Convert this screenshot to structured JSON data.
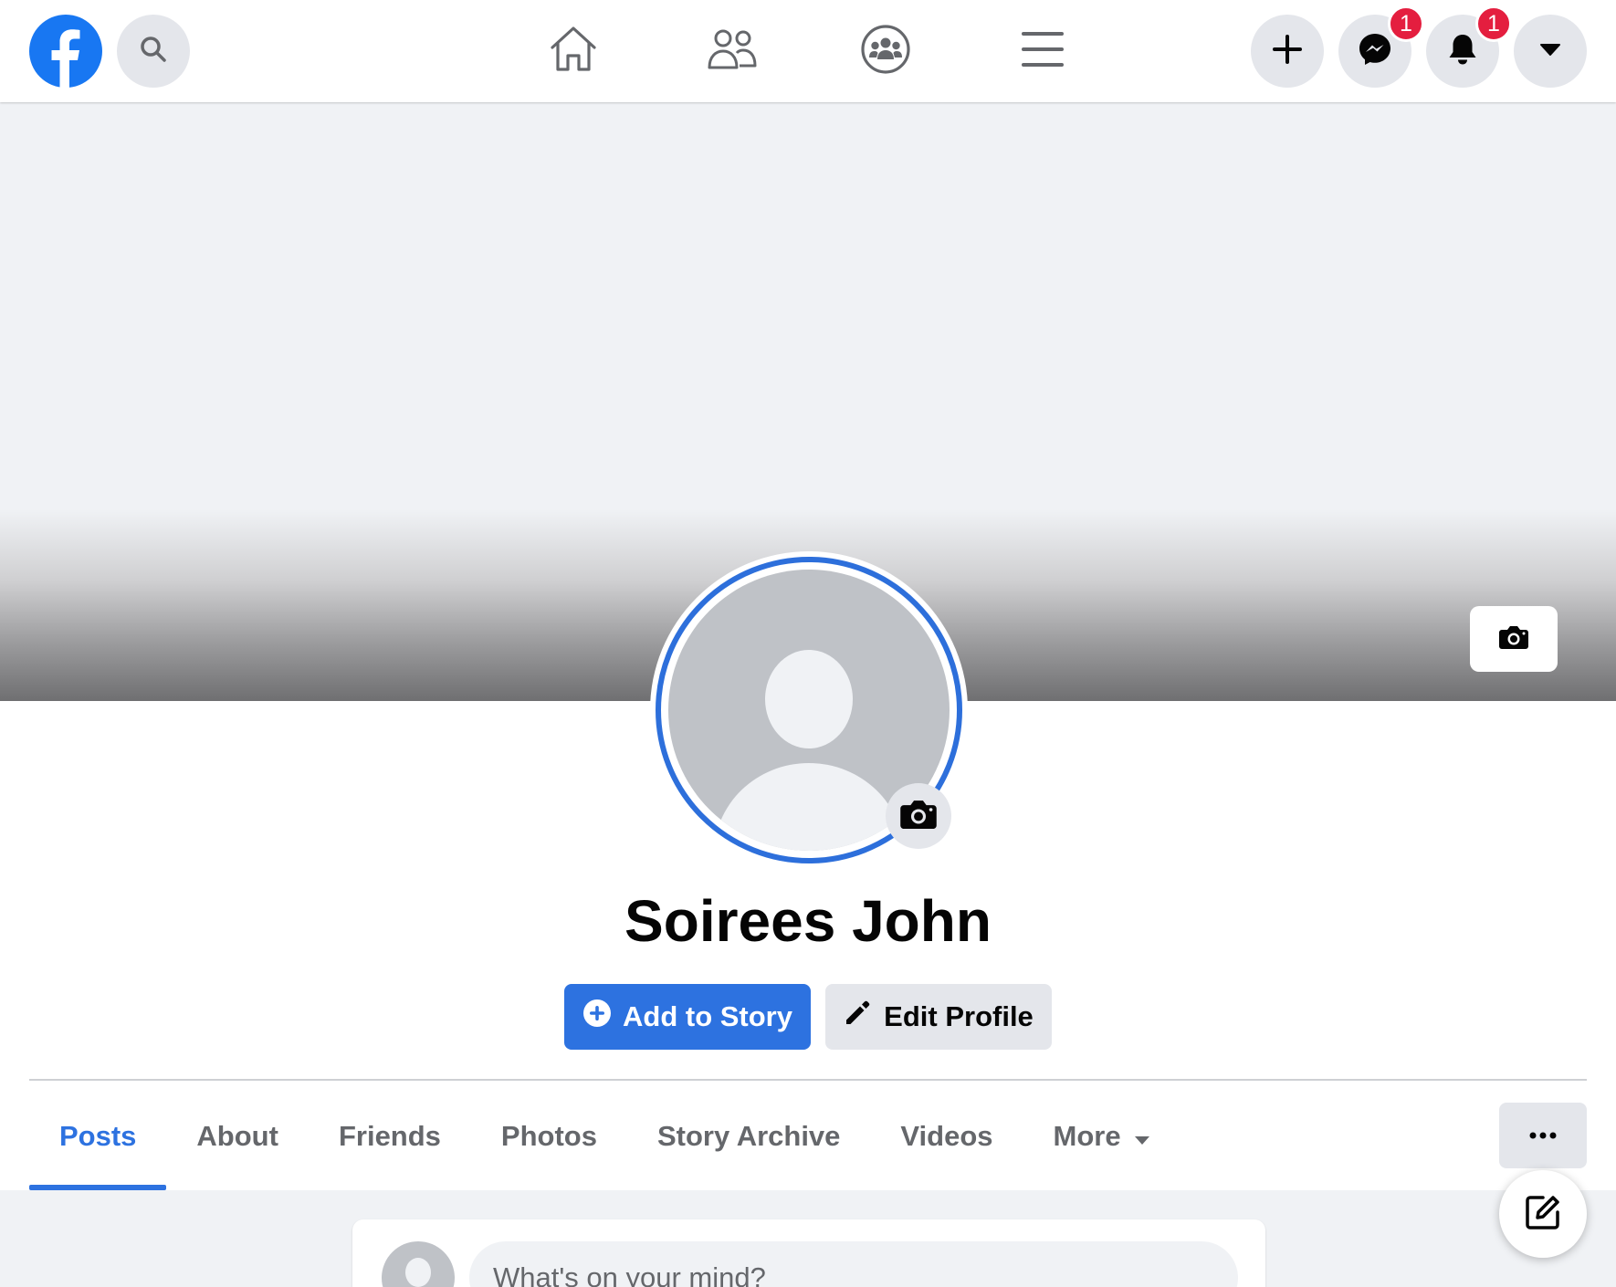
{
  "profile": {
    "name": "Soirees John"
  },
  "actions": {
    "add_story_label": "Add to Story",
    "edit_profile_label": "Edit Profile"
  },
  "tabs": [
    {
      "label": "Posts",
      "active": true
    },
    {
      "label": "About"
    },
    {
      "label": "Friends"
    },
    {
      "label": "Photos"
    },
    {
      "label": "Story Archive"
    },
    {
      "label": "Videos"
    },
    {
      "label": "More"
    }
  ],
  "composer": {
    "placeholder": "What's on your mind?"
  },
  "badges": {
    "messenger": "1",
    "notifications": "1"
  },
  "icons": [
    "facebook-logo",
    "search-icon",
    "home-icon",
    "friends-icon",
    "groups-icon",
    "menu-icon",
    "plus-icon",
    "messenger-icon",
    "bell-icon",
    "caret-down-icon",
    "camera-icon",
    "pencil-icon",
    "more-icon",
    "compose-icon"
  ],
  "colors": {
    "brand": "#1877f2",
    "accent": "#2d72e0",
    "badge": "#e41e3f",
    "surface": "#e4e6eb"
  }
}
